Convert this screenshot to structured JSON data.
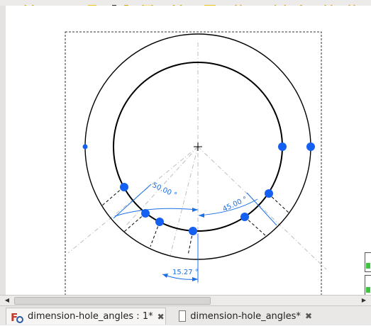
{
  "drawing": {
    "dimensions": [
      {
        "id": "angle-1",
        "label": "50.00 °"
      },
      {
        "id": "angle-2",
        "label": "45.00 °"
      },
      {
        "id": "angle-3",
        "label": "15.27 °"
      }
    ]
  },
  "scrollbar": {
    "left_arrow": "◀",
    "right_arrow": "▶"
  },
  "tabs": [
    {
      "title": "dimension-hole_angles : 1*",
      "close": "✖",
      "active": true
    },
    {
      "title": "dimension-hole_angles*",
      "close": "✖",
      "active": false
    }
  ],
  "colors": {
    "dimension": "#1a6fe6",
    "vertex": "#1560f0",
    "outline": "#000000",
    "construction": "#bcbcbc"
  }
}
